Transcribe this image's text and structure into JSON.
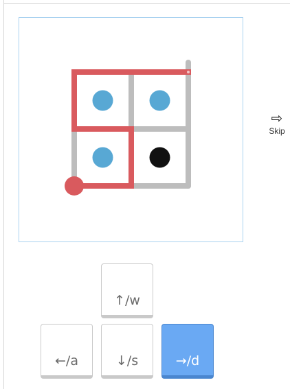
{
  "puzzle": {
    "grid": {
      "cols": 2,
      "rows": 2
    },
    "dots": [
      {
        "col": 0,
        "row": 0,
        "color": "#58a8d4"
      },
      {
        "col": 1,
        "row": 0,
        "color": "#58a8d4"
      },
      {
        "col": 0,
        "row": 1,
        "color": "#58a8d4"
      },
      {
        "col": 1,
        "row": 1,
        "color": "#111111"
      }
    ],
    "path": [
      [
        0,
        2
      ],
      [
        1,
        2
      ],
      [
        1,
        1
      ],
      [
        0,
        1
      ],
      [
        0,
        0
      ],
      [
        2,
        0
      ]
    ],
    "start": [
      0,
      2
    ],
    "end": [
      2,
      0
    ],
    "colors": {
      "grid_line": "#bdbdbd",
      "path": "#d95a5e",
      "panel_border": "#a9d2f0"
    }
  },
  "skip": {
    "icon": "right-arrow-outline-icon",
    "arrow": "⇨",
    "label": "Skip"
  },
  "keys": {
    "up": {
      "label": "↑/w",
      "active": false
    },
    "left": {
      "label": "←/a",
      "active": false
    },
    "down": {
      "label": "↓/s",
      "active": false
    },
    "right": {
      "label": "→/d",
      "active": true
    }
  },
  "colors": {
    "active_key": "#6aa9f3"
  }
}
